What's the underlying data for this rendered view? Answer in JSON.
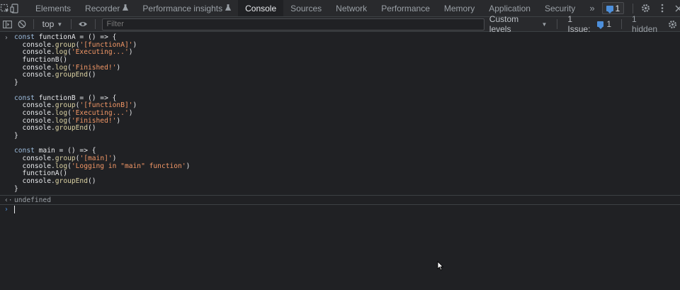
{
  "tabs": [
    {
      "label": "Elements",
      "experimental": false
    },
    {
      "label": "Recorder",
      "experimental": true
    },
    {
      "label": "Performance insights",
      "experimental": true
    },
    {
      "label": "Console",
      "experimental": false,
      "active": true
    },
    {
      "label": "Sources",
      "experimental": false
    },
    {
      "label": "Network",
      "experimental": false
    },
    {
      "label": "Performance",
      "experimental": false
    },
    {
      "label": "Memory",
      "experimental": false
    },
    {
      "label": "Application",
      "experimental": false
    },
    {
      "label": "Security",
      "experimental": false
    }
  ],
  "tabs_overflow": "»",
  "message_count": "1",
  "toolbar": {
    "context": "top",
    "filter_placeholder": "Filter",
    "levels": "Custom levels",
    "issues_label": "1 Issue:",
    "issues_count": "1",
    "hidden": "1 hidden"
  },
  "code_lines": [
    [
      {
        "t": "const ",
        "c": "kw"
      },
      {
        "t": "functionA = () => {",
        "c": "plain"
      }
    ],
    [
      {
        "t": "  console.",
        "c": "plain"
      },
      {
        "t": "group",
        "c": "fn"
      },
      {
        "t": "(",
        "c": "plain"
      },
      {
        "t": "'[functionA]'",
        "c": "str"
      },
      {
        "t": ")",
        "c": "plain"
      }
    ],
    [
      {
        "t": "  console.",
        "c": "plain"
      },
      {
        "t": "log",
        "c": "fn"
      },
      {
        "t": "(",
        "c": "plain"
      },
      {
        "t": "'Executing...'",
        "c": "str"
      },
      {
        "t": ")",
        "c": "plain"
      }
    ],
    [
      {
        "t": "  functionB()",
        "c": "plain"
      }
    ],
    [
      {
        "t": "  console.",
        "c": "plain"
      },
      {
        "t": "log",
        "c": "fn"
      },
      {
        "t": "(",
        "c": "plain"
      },
      {
        "t": "'Finished!'",
        "c": "str"
      },
      {
        "t": ")",
        "c": "plain"
      }
    ],
    [
      {
        "t": "  console.",
        "c": "plain"
      },
      {
        "t": "groupEnd",
        "c": "fn"
      },
      {
        "t": "()",
        "c": "plain"
      }
    ],
    [
      {
        "t": "}",
        "c": "plain"
      }
    ],
    [
      {
        "t": "",
        "c": "plain"
      }
    ],
    [
      {
        "t": "const ",
        "c": "kw"
      },
      {
        "t": "functionB = () => {",
        "c": "plain"
      }
    ],
    [
      {
        "t": "  console.",
        "c": "plain"
      },
      {
        "t": "group",
        "c": "fn"
      },
      {
        "t": "(",
        "c": "plain"
      },
      {
        "t": "'[functionB]'",
        "c": "str"
      },
      {
        "t": ")",
        "c": "plain"
      }
    ],
    [
      {
        "t": "  console.",
        "c": "plain"
      },
      {
        "t": "log",
        "c": "fn"
      },
      {
        "t": "(",
        "c": "plain"
      },
      {
        "t": "'Executing...'",
        "c": "str"
      },
      {
        "t": ")",
        "c": "plain"
      }
    ],
    [
      {
        "t": "  console.",
        "c": "plain"
      },
      {
        "t": "log",
        "c": "fn"
      },
      {
        "t": "(",
        "c": "plain"
      },
      {
        "t": "'Finished!'",
        "c": "str"
      },
      {
        "t": ")",
        "c": "plain"
      }
    ],
    [
      {
        "t": "  console.",
        "c": "plain"
      },
      {
        "t": "groupEnd",
        "c": "fn"
      },
      {
        "t": "()",
        "c": "plain"
      }
    ],
    [
      {
        "t": "}",
        "c": "plain"
      }
    ],
    [
      {
        "t": "",
        "c": "plain"
      }
    ],
    [
      {
        "t": "const ",
        "c": "kw"
      },
      {
        "t": "main = () => {",
        "c": "plain"
      }
    ],
    [
      {
        "t": "  console.",
        "c": "plain"
      },
      {
        "t": "group",
        "c": "fn"
      },
      {
        "t": "(",
        "c": "plain"
      },
      {
        "t": "'[main]'",
        "c": "str"
      },
      {
        "t": ")",
        "c": "plain"
      }
    ],
    [
      {
        "t": "  console.",
        "c": "plain"
      },
      {
        "t": "log",
        "c": "fn"
      },
      {
        "t": "(",
        "c": "plain"
      },
      {
        "t": "'Logging in \"main\" function'",
        "c": "str"
      },
      {
        "t": ")",
        "c": "plain"
      }
    ],
    [
      {
        "t": "  functionA()",
        "c": "plain"
      }
    ],
    [
      {
        "t": "  console.",
        "c": "plain"
      },
      {
        "t": "groupEnd",
        "c": "fn"
      },
      {
        "t": "()",
        "c": "plain"
      }
    ],
    [
      {
        "t": "}",
        "c": "plain"
      }
    ]
  ],
  "prompt_glyph": "›",
  "result_glyph": "‹·",
  "result_text": "undefined",
  "colors": {
    "keyword": "#9bbbdc",
    "string": "#f29766",
    "function": "#dcd3a3",
    "accent": "#4d8fdb"
  }
}
